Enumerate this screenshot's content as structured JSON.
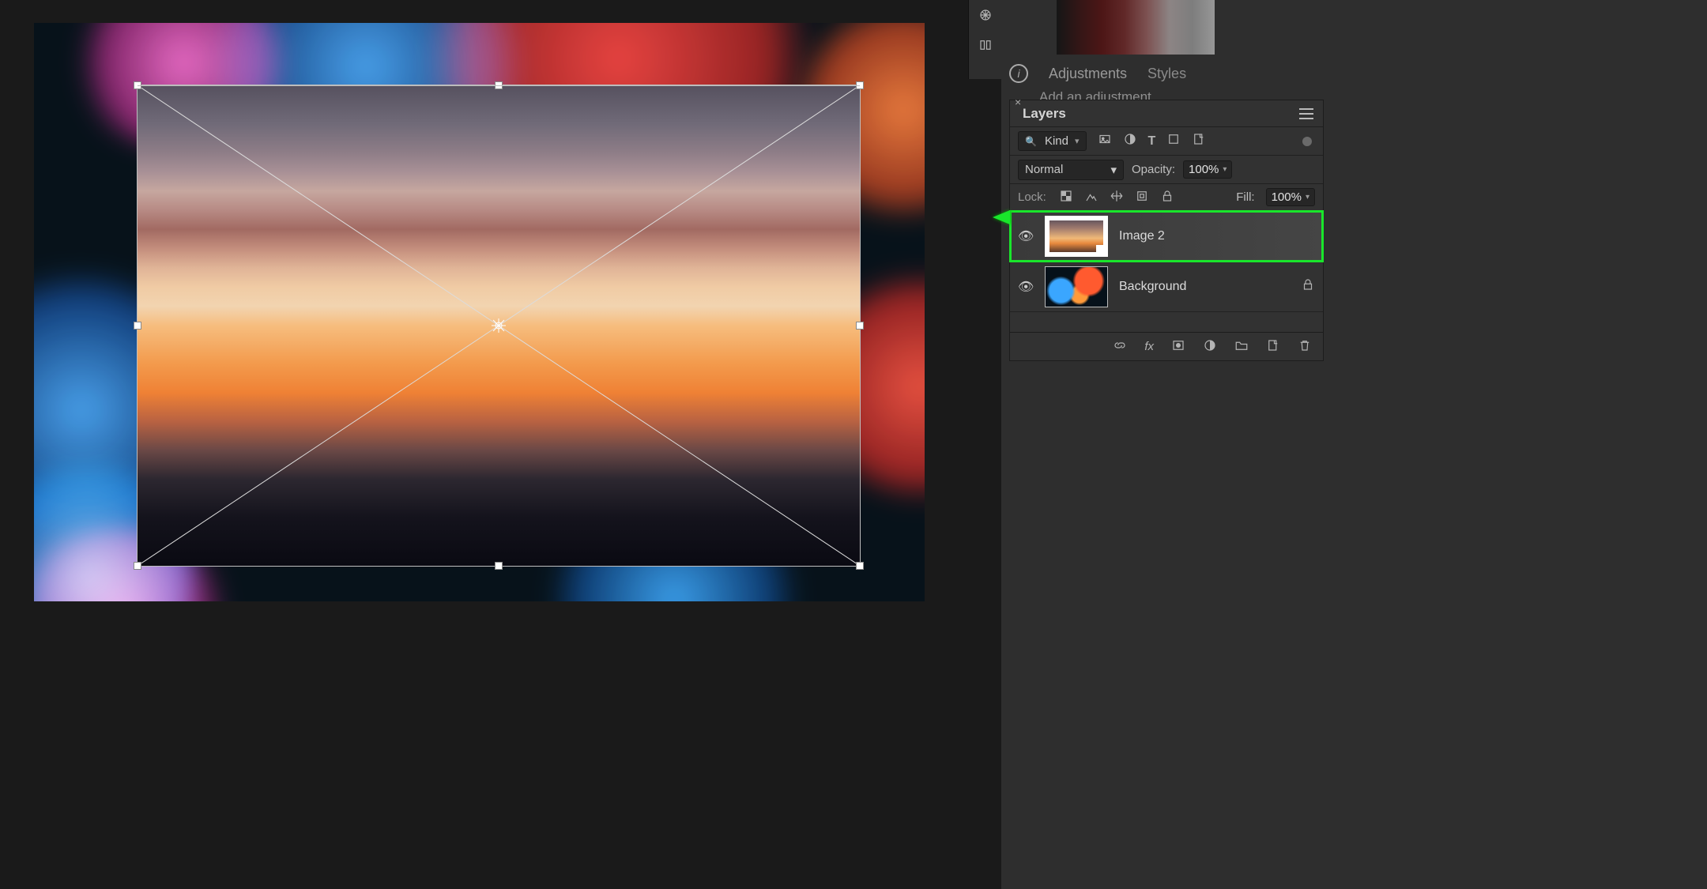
{
  "panels": {
    "info_icon_title": "Info",
    "adjustments_tab": "Adjustments",
    "styles_tab": "Styles",
    "adjustments_hint": "Add an adjustment"
  },
  "layers_panel": {
    "title": "Layers",
    "filter": {
      "label": "Kind"
    },
    "blend_mode": "Normal",
    "opacity_label": "Opacity:",
    "opacity_value": "100%",
    "lock_label": "Lock:",
    "fill_label": "Fill:",
    "fill_value": "100%",
    "layers": [
      {
        "name": "Image 2",
        "visible": true,
        "selected": true,
        "locked": false,
        "smart": true
      },
      {
        "name": "Background",
        "visible": true,
        "selected": false,
        "locked": true,
        "smart": false
      }
    ],
    "footer_icons": [
      "link",
      "fx",
      "mask",
      "adjust",
      "group",
      "new",
      "trash"
    ]
  },
  "canvas": {
    "transform_active": true
  }
}
